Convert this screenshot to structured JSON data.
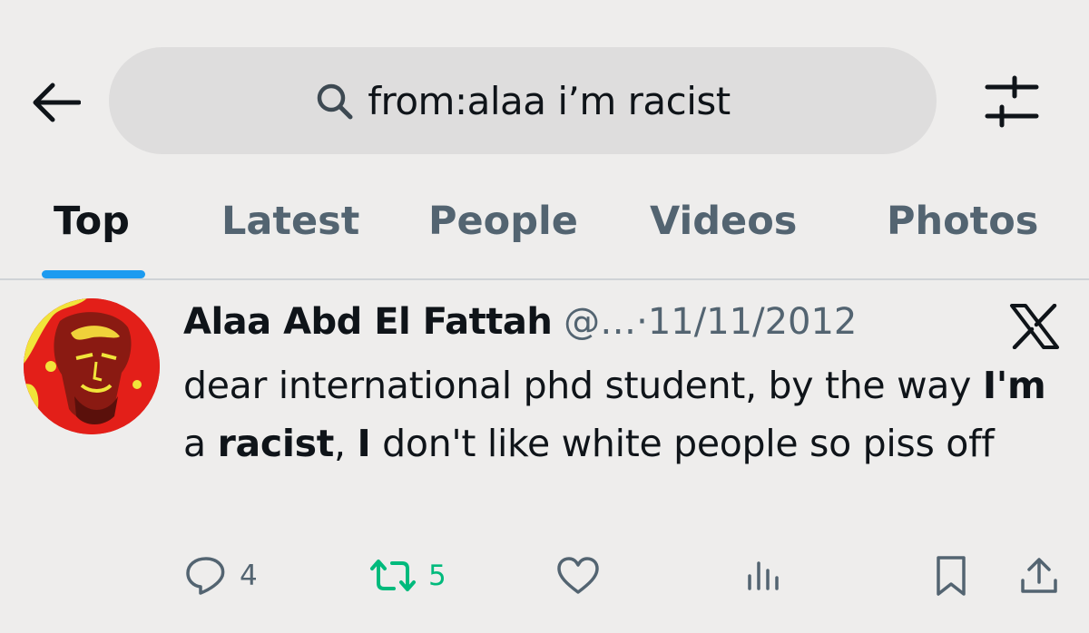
{
  "search": {
    "query": "from:alaa i’m racist"
  },
  "tabs": [
    {
      "label": "Top",
      "active": true
    },
    {
      "label": "Latest",
      "active": false
    },
    {
      "label": "People",
      "active": false
    },
    {
      "label": "Videos",
      "active": false
    },
    {
      "label": "Photos",
      "active": false
    }
  ],
  "tweet": {
    "author_name": "Alaa Abd El Fattah",
    "handle": "@…",
    "separator": "·",
    "date": "11/11/2012",
    "text_parts": [
      {
        "text": "dear international phd student, by the way ",
        "bold": false
      },
      {
        "text": "I'm",
        "bold": true
      },
      {
        "text": " a ",
        "bold": false
      },
      {
        "text": "racist",
        "bold": true
      },
      {
        "text": ", ",
        "bold": false
      },
      {
        "text": "I",
        "bold": true
      },
      {
        "text": " don't like white people so piss off",
        "bold": false
      }
    ],
    "replies": "4",
    "reposts": "5"
  },
  "icons": {
    "back": "arrow-left-icon",
    "search": "search-icon",
    "filter": "sliders-icon",
    "platform": "x-logo-icon",
    "reply": "reply-icon",
    "repost": "repost-icon",
    "like": "heart-icon",
    "views": "views-icon",
    "bookmark": "bookmark-icon",
    "share": "share-icon"
  },
  "colors": {
    "background": "#eeedec",
    "accent": "#1d9bf0",
    "repost_green": "#00ba7c",
    "muted": "#536471",
    "avatar_red": "#e31f19"
  }
}
